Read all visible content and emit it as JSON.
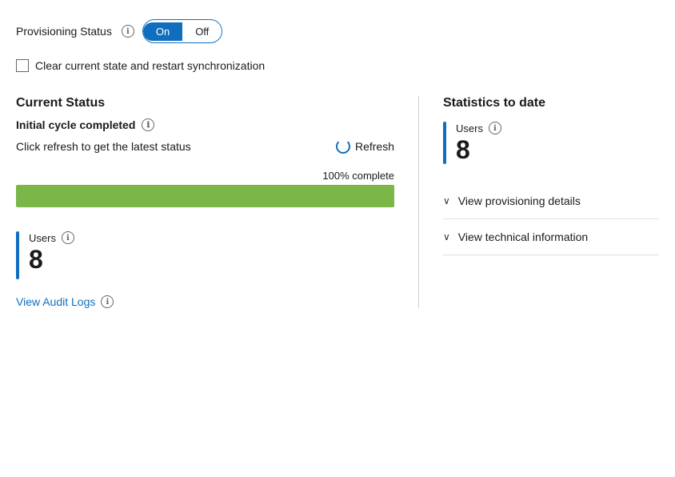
{
  "provisioning": {
    "status_label": "Provisioning Status",
    "toggle_on": "On",
    "toggle_off": "Off",
    "info_icon": "ℹ"
  },
  "checkbox": {
    "label": "Clear current state and restart synchronization"
  },
  "left": {
    "current_status_title": "Current Status",
    "initial_cycle_label": "Initial cycle completed",
    "refresh_text": "Click refresh to get the latest status",
    "refresh_btn_label": "Refresh",
    "progress_label": "100% complete",
    "progress_value": 100,
    "users_label": "Users",
    "users_count": "8",
    "audit_link": "View Audit Logs"
  },
  "right": {
    "stats_title": "Statistics to date",
    "users_label": "Users",
    "users_count": "8",
    "view_provisioning": "View provisioning details",
    "view_technical": "View technical information",
    "chevron": "∨"
  }
}
